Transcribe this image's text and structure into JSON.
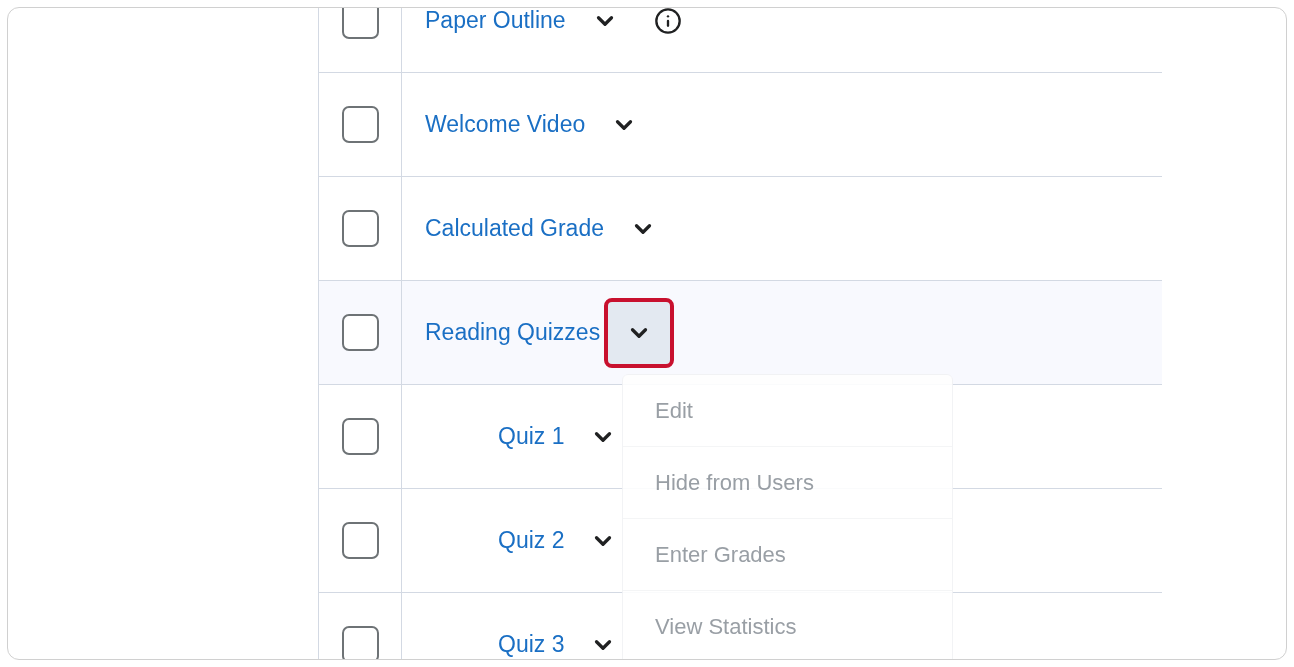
{
  "rows": [
    {
      "name": "Paper Outline",
      "checked": false,
      "info": true,
      "expanded": false
    },
    {
      "name": "Welcome Video",
      "checked": false,
      "info": false,
      "expanded": false
    },
    {
      "name": "Calculated Grade",
      "checked": false,
      "info": false,
      "expanded": false
    },
    {
      "name": "Reading Quizzes",
      "checked": false,
      "info": false,
      "expanded": true,
      "children": [
        {
          "name": "Quiz 1",
          "checked": false,
          "info": false,
          "expanded": false
        },
        {
          "name": "Quiz 2",
          "checked": false,
          "info": false,
          "expanded": false
        },
        {
          "name": "Quiz 3",
          "checked": false,
          "info": false,
          "expanded": false
        }
      ]
    }
  ],
  "menu": {
    "items": [
      "Edit",
      "Hide from Users",
      "Enter Grades",
      "View Statistics"
    ]
  }
}
